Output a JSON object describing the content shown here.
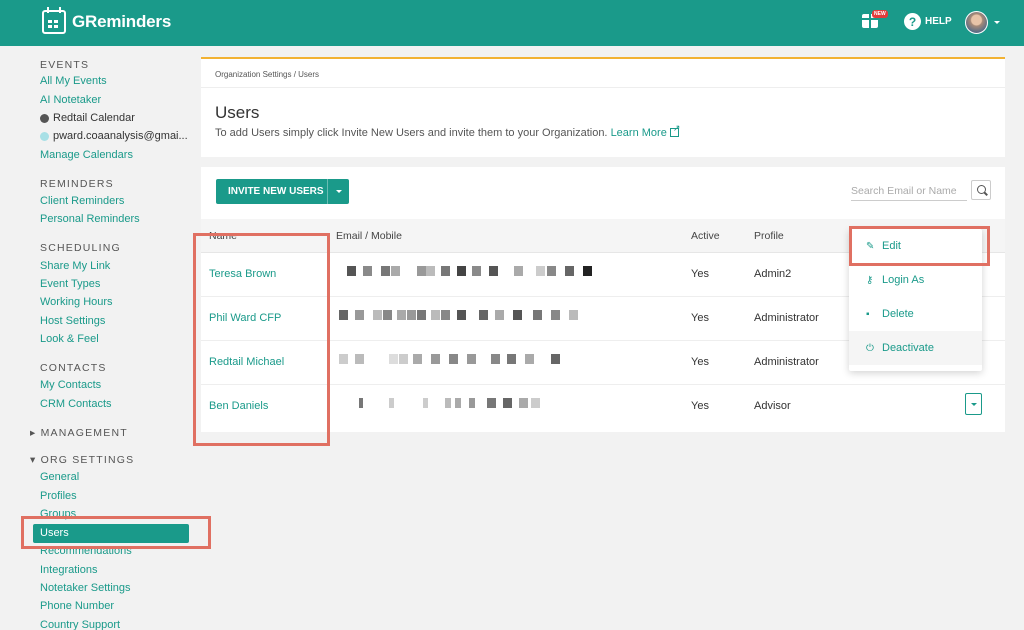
{
  "app": {
    "name": "GReminders"
  },
  "topbar": {
    "new_badge": "NEW",
    "help_label": "HELP"
  },
  "sidebar": {
    "events": {
      "heading": "EVENTS",
      "items": [
        "All My Events",
        "AI Notetaker"
      ],
      "calendars": [
        {
          "label": "Redtail Calendar",
          "color": "#555555"
        },
        {
          "label": "pward.coaanalysis@gmai...",
          "color": "#a8e0e6"
        }
      ],
      "manage": "Manage Calendars"
    },
    "reminders": {
      "heading": "REMINDERS",
      "items": [
        "Client Reminders",
        "Personal Reminders"
      ]
    },
    "scheduling": {
      "heading": "SCHEDULING",
      "items": [
        "Share My Link",
        "Event Types",
        "Working Hours",
        "Host Settings",
        "Look & Feel"
      ]
    },
    "contacts": {
      "heading": "CONTACTS",
      "items": [
        "My Contacts",
        "CRM Contacts"
      ]
    },
    "management": {
      "heading": "MANAGEMENT"
    },
    "org_settings": {
      "heading": "ORG SETTINGS",
      "items": [
        "General",
        "Profiles",
        "Groups",
        "Users",
        "Recommendations",
        "Integrations",
        "Notetaker Settings",
        "Phone Number",
        "Country Support"
      ],
      "active": "Users"
    }
  },
  "breadcrumb": "Organization Settings / Users",
  "page": {
    "title": "Users",
    "subtitle": "To add Users simply click Invite New Users and invite them to your Organization.",
    "learn_more": "Learn More"
  },
  "toolbar": {
    "invite_label": "INVITE NEW USERS",
    "search_placeholder": "Search Email or Name"
  },
  "table": {
    "headers": {
      "name": "Name",
      "email": "Email / Mobile",
      "active": "Active",
      "profile": "Profile"
    },
    "rows": [
      {
        "name": "Teresa Brown",
        "active": "Yes",
        "profile": "Admin2"
      },
      {
        "name": "Phil Ward CFP",
        "active": "Yes",
        "profile": "Administrator"
      },
      {
        "name": "Redtail Michael",
        "active": "Yes",
        "profile": "Administrator"
      },
      {
        "name": "Ben Daniels",
        "active": "Yes",
        "profile": "Advisor"
      }
    ]
  },
  "row_menu": {
    "items": [
      "Edit",
      "Login As",
      "Delete",
      "Deactivate"
    ]
  },
  "colors": {
    "brand": "#1a9a8a",
    "highlight": "#e07062",
    "accent_top": "#f2b233"
  }
}
